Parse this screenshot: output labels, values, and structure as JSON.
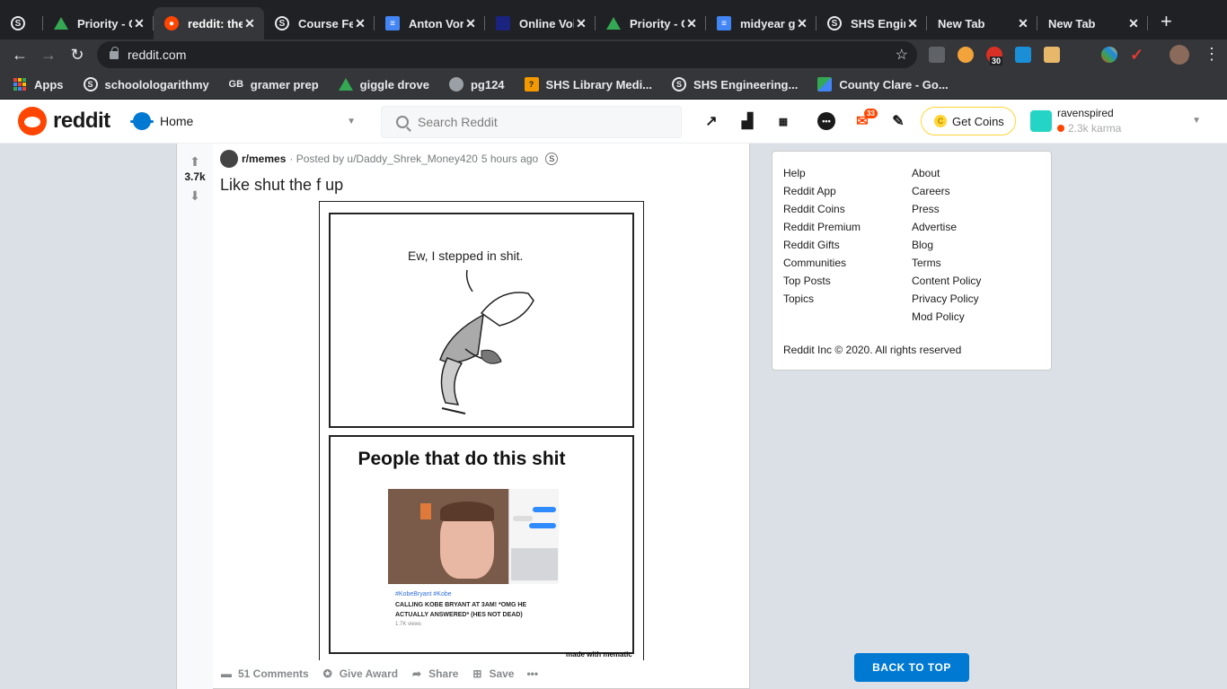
{
  "browser": {
    "tabs": [
      {
        "title": "",
        "icon": "schoology-icon"
      },
      {
        "title": "Priority - G",
        "icon": "drive-icon"
      },
      {
        "title": "reddit: the",
        "icon": "reddit-icon",
        "active": true
      },
      {
        "title": "Course Fe",
        "icon": "schoology-icon"
      },
      {
        "title": "Anton Vor",
        "icon": "docs-icon"
      },
      {
        "title": "Online Voi",
        "icon": "voice-icon"
      },
      {
        "title": "Priority - G",
        "icon": "drive-icon"
      },
      {
        "title": "midyear gr",
        "icon": "docs-icon"
      },
      {
        "title": "SHS Engin",
        "icon": "schoology-icon"
      },
      {
        "title": "New Tab",
        "icon": ""
      },
      {
        "title": "New Tab",
        "icon": ""
      }
    ],
    "url": "reddit.com",
    "ext_badge": "30",
    "bookmarks": [
      {
        "label": "Apps",
        "icon": "apps-grid-icon"
      },
      {
        "label": "schoolologarithmy",
        "icon": "schoology-icon"
      },
      {
        "label": "gramer prep",
        "icon": "gb-icon"
      },
      {
        "label": "giggle drove",
        "icon": "drive-icon"
      },
      {
        "label": "pg124",
        "icon": "globe-icon"
      },
      {
        "label": "SHS Library Medi...",
        "icon": "library-icon"
      },
      {
        "label": "SHS Engineering...",
        "icon": "schoology-icon"
      },
      {
        "label": "County Clare - Go...",
        "icon": "maps-icon"
      }
    ]
  },
  "reddit": {
    "header": {
      "wordmark": "reddit",
      "feed_label": "Home",
      "search_placeholder": "Search Reddit",
      "mail_count": "33",
      "get_coins": "Get Coins",
      "username": "ravenspired",
      "karma": "2.3k karma"
    },
    "post": {
      "votes": "3.7k",
      "subreddit": "r/memes",
      "posted_by": "· Posted by u/Daddy_Shrek_Money420",
      "time": "5 hours ago",
      "title": "Like shut the f up",
      "meme": {
        "speech": "Ew, I stepped in shit.",
        "caption": "People that do this shit",
        "video_tags": "#KobeBryant #Kobe",
        "video_title": "CALLING KOBE BRYANT AT 3AM! *OMG HE ACTUALLY ANSWERED* (HES NOT DEAD)",
        "video_views": "1.7K views",
        "watermark": "made with mematic"
      },
      "actions": {
        "comments": "51 Comments",
        "award": "Give Award",
        "share": "Share",
        "save": "Save"
      }
    },
    "sidebar": {
      "left_links": [
        "Help",
        "Reddit App",
        "Reddit Coins",
        "Reddit Premium",
        "Reddit Gifts",
        "Communities",
        "Top Posts",
        "Topics"
      ],
      "right_links": [
        "About",
        "Careers",
        "Press",
        "Advertise",
        "Blog",
        "Terms",
        "Content Policy",
        "Privacy Policy",
        "Mod Policy"
      ],
      "copyright": "Reddit Inc © 2020. All rights reserved"
    },
    "back_to_top": "BACK TO TOP"
  },
  "colors": {
    "reddit_orange": "#ff4500",
    "reddit_blue": "#0079d3",
    "page_bg": "#dae0e6",
    "chrome_dark": "#202124",
    "coins_border": "#ffd635"
  }
}
